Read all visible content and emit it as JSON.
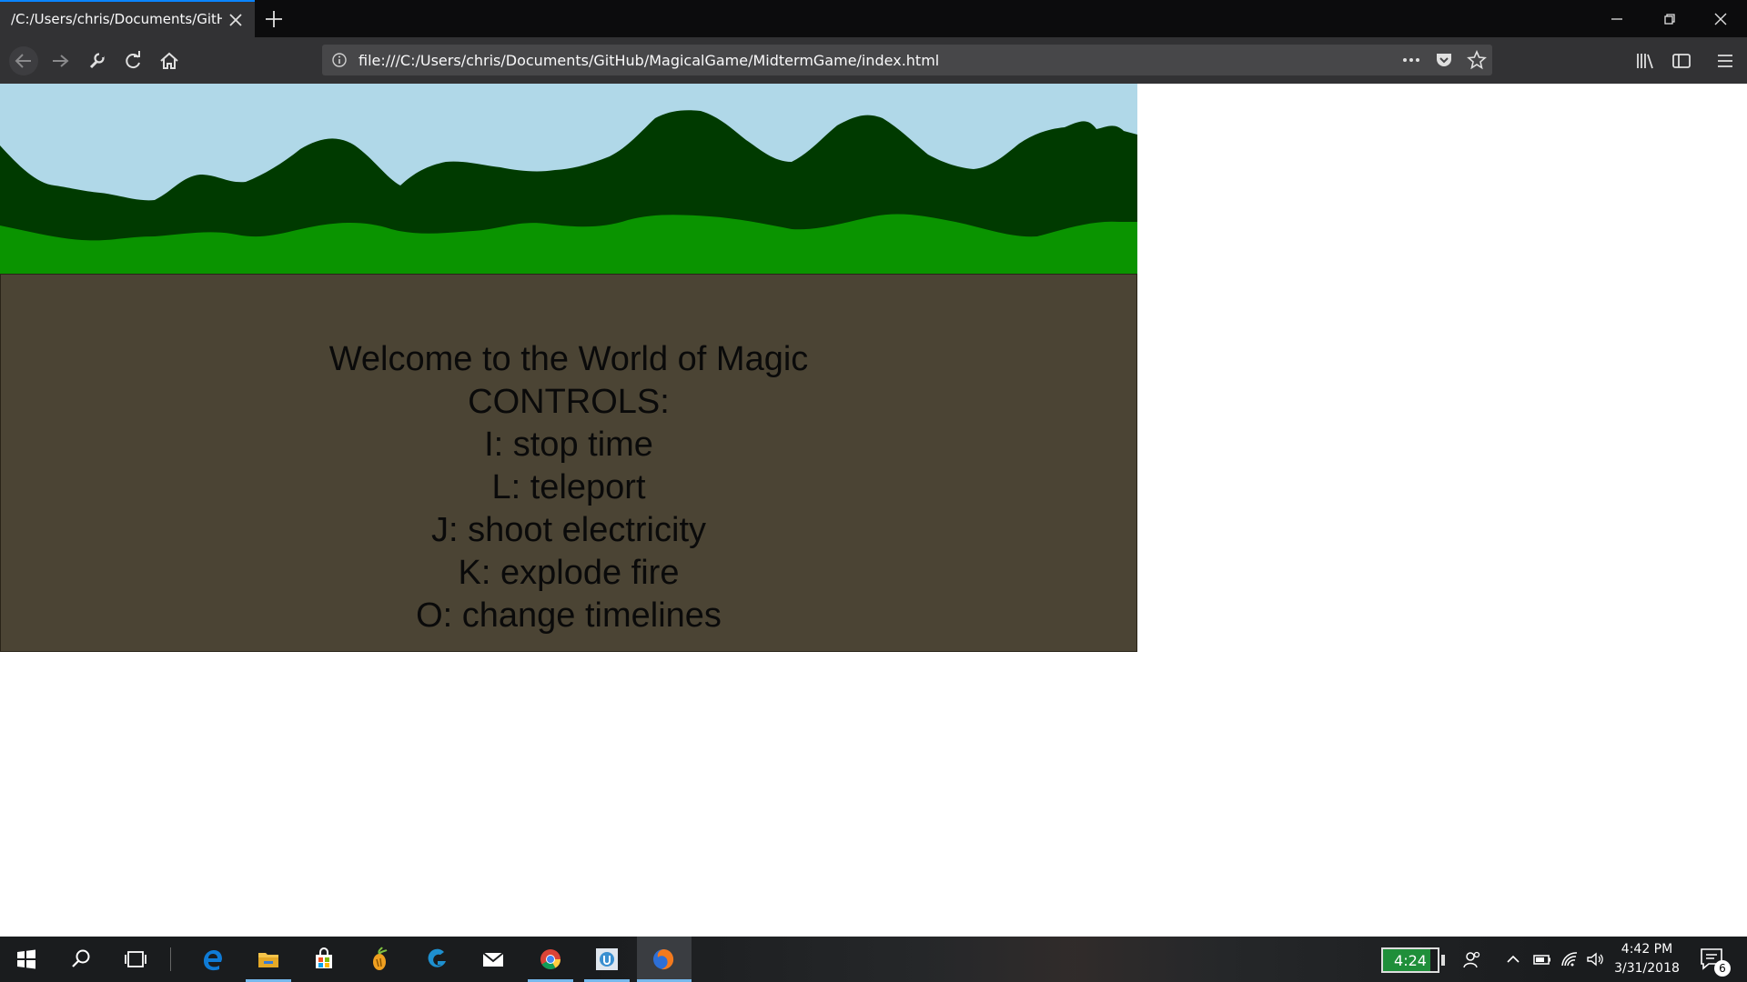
{
  "browser": {
    "tab_title": "/C:/Users/chris/Documents/GitHub/",
    "url": "file:///C:/Users/chris/Documents/GitHub/MagicalGame/MidtermGame/index.html",
    "icons": [
      "back-icon",
      "forward-icon",
      "wrench-icon",
      "reload-icon",
      "home-icon",
      "page-info-icon",
      "more-actions-icon",
      "pocket-icon",
      "bookmark-star-icon",
      "library-icon",
      "sidebar-icon",
      "hamburger-menu-icon",
      "close-icon",
      "plus-icon",
      "minimize-icon",
      "restore-icon",
      "window-close-icon"
    ]
  },
  "game": {
    "colors": {
      "sky": "#b0d8e8",
      "mountains_far": "#003a00",
      "hills_near": "#0a9400",
      "ground": "#4b4434"
    },
    "lines": [
      "Welcome to the World of Magic",
      "CONTROLS:",
      "I: stop time",
      "L: teleport",
      "J: shoot electricity",
      "K: explode fire",
      "O: change timelines"
    ]
  },
  "taskbar": {
    "apps": [
      "windows-start-icon",
      "search-icon",
      "task-view-icon",
      "edge-icon",
      "file-explorer-icon",
      "store-icon",
      "fl-studio-icon",
      "logitech-g-icon",
      "mail-icon",
      "chrome-icon",
      "unity-icon",
      "firefox-icon"
    ],
    "battery_time": "4:24",
    "clock_time": "4:42 PM",
    "clock_date": "3/31/2018",
    "notification_count": "6"
  }
}
